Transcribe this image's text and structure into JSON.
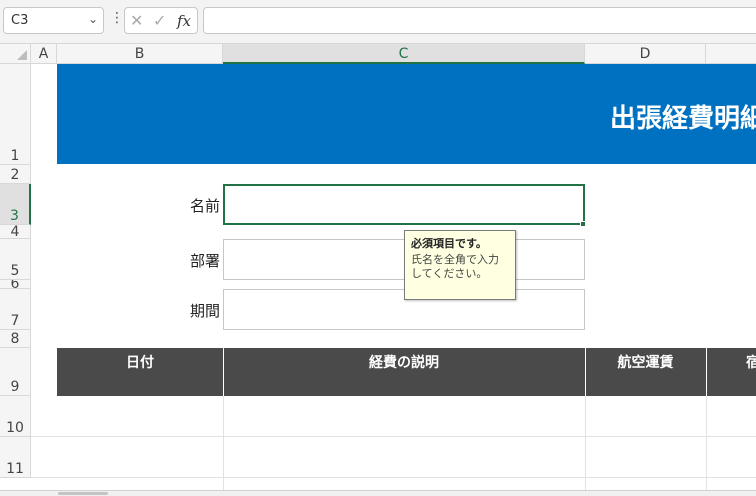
{
  "formula_bar": {
    "name_box": "C3",
    "formula_value": "",
    "cancel_icon": "close-icon",
    "enter_icon": "check-icon",
    "fx_label": "fx"
  },
  "columns": [
    "A",
    "B",
    "C",
    "D"
  ],
  "selected_column": "C",
  "rows": [
    "1",
    "2",
    "3",
    "4",
    "5",
    "6",
    "7",
    "8",
    "9",
    "10",
    "11"
  ],
  "selected_row": "3",
  "sheet": {
    "title": "出張経費明細",
    "labels": {
      "name": "名前",
      "department": "部署",
      "period": "期間"
    },
    "fields": {
      "name": "",
      "department": "",
      "period": ""
    },
    "table_headers": [
      "日付",
      "経費の説明",
      "航空運賃",
      "宿泊費"
    ]
  },
  "tooltip": {
    "title": "必須項目です。",
    "body": "氏名を全角で入力してください。"
  },
  "colors": {
    "banner": "#0070c0",
    "table_header": "#4a4a4a",
    "selection": "#217346",
    "tooltip_bg": "#ffffe1"
  }
}
